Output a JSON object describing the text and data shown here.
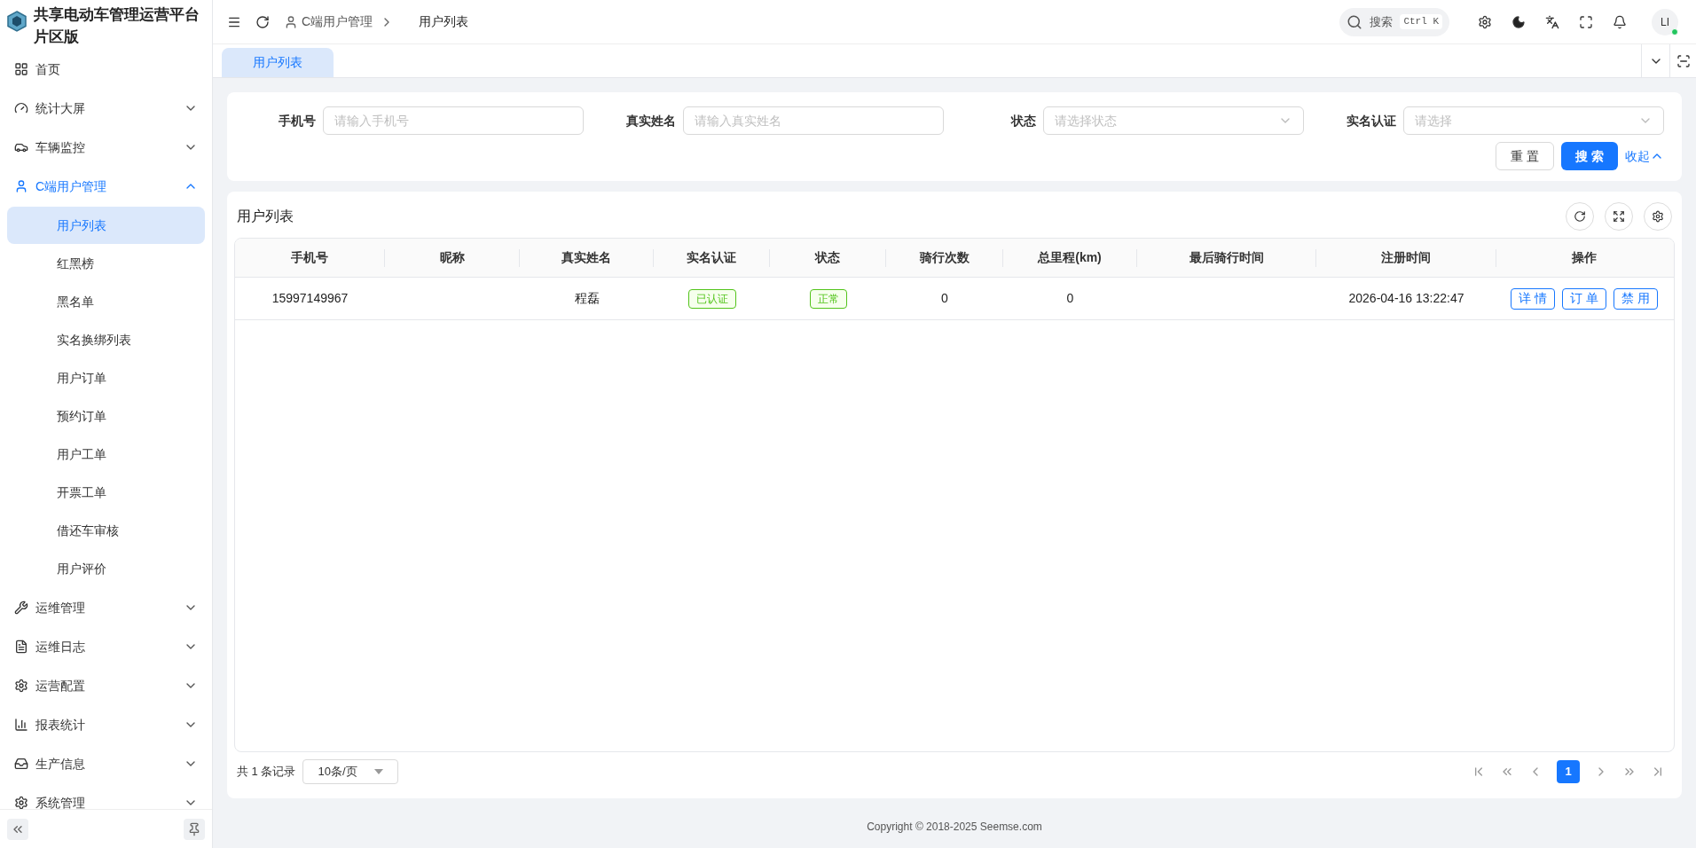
{
  "app": {
    "title_line_1": "共享电动车管理运营平台",
    "title_line_2": "片区版"
  },
  "sidebar": {
    "items": [
      {
        "label": "首页",
        "selected": false
      },
      {
        "label": "统计大屏",
        "expanded": false,
        "selected": false
      },
      {
        "label": "车辆监控",
        "expanded": false,
        "selected": false
      },
      {
        "label": "C端用户管理",
        "expanded": true,
        "selected": true,
        "children": [
          {
            "label": "用户列表",
            "selected": true
          },
          {
            "label": "红黑榜",
            "selected": false
          },
          {
            "label": "黑名单",
            "selected": false
          },
          {
            "label": "实名换绑列表",
            "selected": false
          },
          {
            "label": "用户订单",
            "selected": false
          },
          {
            "label": "预约订单",
            "selected": false
          },
          {
            "label": "用户工单",
            "selected": false
          },
          {
            "label": "开票工单",
            "selected": false
          },
          {
            "label": "借还车审核",
            "selected": false
          },
          {
            "label": "用户评价",
            "selected": false
          }
        ]
      },
      {
        "label": "运维管理",
        "expanded": false,
        "selected": false
      },
      {
        "label": "运维日志",
        "expanded": false,
        "selected": false
      },
      {
        "label": "运营配置",
        "expanded": false,
        "selected": false
      },
      {
        "label": "报表统计",
        "expanded": false,
        "selected": false
      },
      {
        "label": "生产信息",
        "expanded": false,
        "selected": false
      },
      {
        "label": "系统管理",
        "expanded": false,
        "selected": false
      }
    ]
  },
  "header": {
    "breadcrumb": [
      "C端用户管理",
      "用户列表"
    ],
    "search_label": "搜索",
    "search_shortcut": "Ctrl K",
    "avatar": "LI",
    "online": true
  },
  "tabs": [
    {
      "label": "用户列表",
      "selected": true
    }
  ],
  "filters": {
    "fields": [
      {
        "kind": "input",
        "label": "手机号",
        "placeholder": "请输入手机号"
      },
      {
        "kind": "input",
        "label": "真实姓名",
        "placeholder": "请输入真实姓名"
      },
      {
        "kind": "select",
        "label": "状态",
        "placeholder": "请选择状态"
      },
      {
        "kind": "select",
        "label": "实名认证",
        "placeholder": "请选择"
      }
    ],
    "reset": "重 置",
    "search": "搜 索",
    "collapse": "收起"
  },
  "table": {
    "title": "用户列表",
    "columns": [
      "手机号",
      "昵称",
      "真实姓名",
      "实名认证",
      "状态",
      "骑行次数",
      "总里程(km)",
      "最后骑行时间",
      "注册时间",
      "操作"
    ],
    "rows": [
      {
        "phone": "15997149967",
        "real_name": "程磊",
        "verified": {
          "label": "已认证",
          "color": "#52c41a"
        },
        "status": {
          "label": "正常",
          "color": "#52c41a"
        },
        "rides": "0",
        "mileage": "0",
        "registered": "2026-04-16 13:22:47",
        "actions": [
          "详 情",
          "订 单",
          "禁 用"
        ]
      }
    ]
  },
  "pagination": {
    "total": "共 1 条记录",
    "page_size": "10条/页",
    "pages": [
      {
        "label": "1",
        "selected": true
      }
    ]
  },
  "footer": "Copyright © 2018-2025 Seemse.com"
}
